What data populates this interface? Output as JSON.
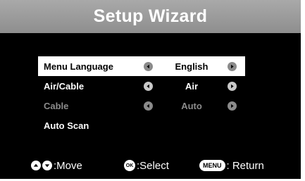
{
  "header": {
    "title": "Setup Wizard"
  },
  "menu": {
    "items": [
      {
        "label": "Menu Language",
        "value": "English"
      },
      {
        "label": "Air/Cable",
        "value": "Air"
      },
      {
        "label": "Cable",
        "value": "Auto"
      },
      {
        "label": "Auto Scan"
      }
    ]
  },
  "footer": {
    "move_label": ":Move",
    "select_key": "OK",
    "select_label": ":Select",
    "return_key": "MENU",
    "return_label": ": Return"
  },
  "colors": {
    "header_bg": "#999999",
    "background": "#000000",
    "selected_row": "#ffffff",
    "disabled_text": "#8c8c8c"
  },
  "icons": [
    "arrow-left-icon",
    "arrow-right-icon",
    "up-button-icon",
    "down-button-icon",
    "ok-button-icon",
    "menu-button-icon"
  ]
}
